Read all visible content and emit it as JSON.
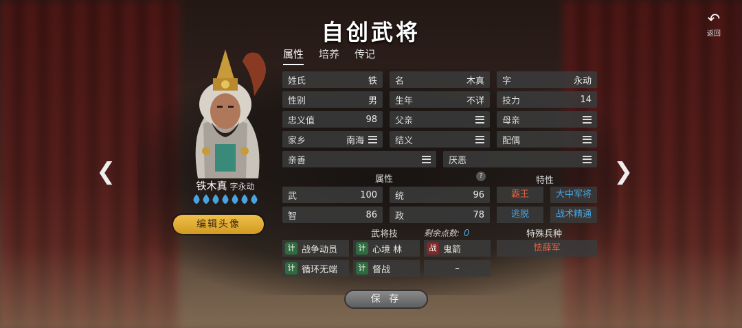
{
  "header": {
    "title": "自创武将",
    "back_label": "返回"
  },
  "tabs": [
    {
      "label": "属性"
    },
    {
      "label": "培养"
    },
    {
      "label": "传记"
    }
  ],
  "character": {
    "name": "铁木真",
    "zi": "字永动",
    "edit_label": "编辑头像",
    "drop_count": 7
  },
  "info": [
    {
      "key": "姓氏",
      "value": "铁"
    },
    {
      "key": "名",
      "value": "木真"
    },
    {
      "key": "字",
      "value": "永动"
    },
    {
      "key": "性别",
      "value": "男"
    },
    {
      "key": "生年",
      "value": "不详"
    },
    {
      "key": "技力",
      "value": "14"
    },
    {
      "key": "忠义值",
      "value": "98"
    },
    {
      "key": "父亲",
      "value": ""
    },
    {
      "key": "母亲",
      "value": ""
    },
    {
      "key": "家乡",
      "value": "南海"
    },
    {
      "key": "结义",
      "value": ""
    },
    {
      "key": "配偶",
      "value": ""
    },
    {
      "key": "亲善",
      "value": ""
    },
    {
      "key": "厌恶",
      "value": ""
    }
  ],
  "attributes": {
    "label": "属性",
    "help": "?",
    "items": [
      {
        "key": "武",
        "value": "100"
      },
      {
        "key": "统",
        "value": "96"
      },
      {
        "key": "智",
        "value": "86"
      },
      {
        "key": "政",
        "value": "78"
      }
    ]
  },
  "traits": {
    "label": "特性",
    "items": [
      {
        "label": "霸王",
        "color": "#e0603c"
      },
      {
        "label": "大中军将",
        "color": "#4aa3e0"
      },
      {
        "label": "逃脱",
        "color": "#4aa3e0"
      },
      {
        "label": "战术精通",
        "color": "#4aa3e0"
      }
    ]
  },
  "skills": {
    "label": "武将技",
    "remaining_label": "剩余点数:",
    "remaining_value": "0",
    "items": [
      {
        "badge": "计",
        "label": "战争动员"
      },
      {
        "badge": "计",
        "label": "心境 林"
      },
      {
        "badge": "战",
        "label": "鬼箭"
      },
      {
        "badge": "计",
        "label": "循环无端"
      },
      {
        "badge": "计",
        "label": "督战"
      },
      {
        "badge": "",
        "label": "–"
      }
    ]
  },
  "special_troop": {
    "label": "特殊兵种",
    "value": "怯薛军"
  },
  "actions": {
    "save_label": "保 存"
  },
  "colors": {
    "accent": "#e3ad36",
    "drop": "#4aa3e0"
  }
}
